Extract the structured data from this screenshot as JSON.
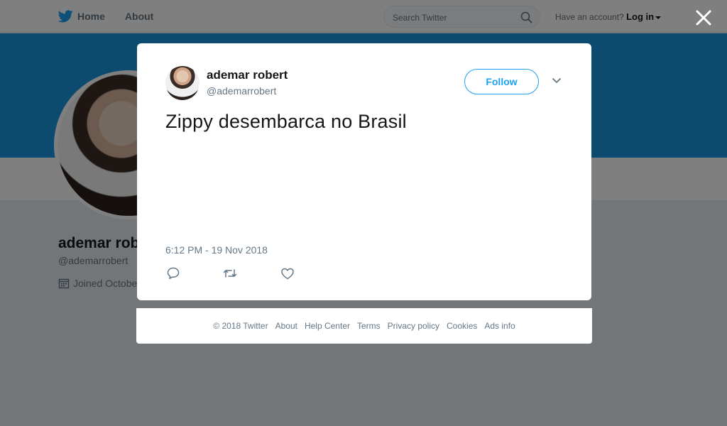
{
  "nav": {
    "home_label": "Home",
    "about_label": "About",
    "search_placeholder": "Search Twitter",
    "account_prompt": "Have an account?",
    "login_label": "Log in"
  },
  "profile": {
    "name": "ademar rob",
    "handle": "@ademarrobert",
    "joined": "Joined Octobe"
  },
  "tweet": {
    "author_name": "ademar robert",
    "author_handle": "@ademarrobert",
    "follow_label": "Follow",
    "text": "Zippy desembarca no Brasil",
    "timestamp": "6:12 PM - 19 Nov 2018"
  },
  "footer": {
    "copyright": "© 2018 Twitter",
    "links": [
      "About",
      "Help Center",
      "Terms",
      "Privacy policy",
      "Cookies",
      "Ads info"
    ]
  },
  "colors": {
    "brand": "#1da1f2",
    "banner": "#1b95e0"
  },
  "icons": [
    "twitter-bird-icon",
    "search-icon",
    "calendar-icon",
    "close-icon",
    "chevron-down-icon",
    "reply-icon",
    "retweet-icon",
    "like-icon"
  ]
}
